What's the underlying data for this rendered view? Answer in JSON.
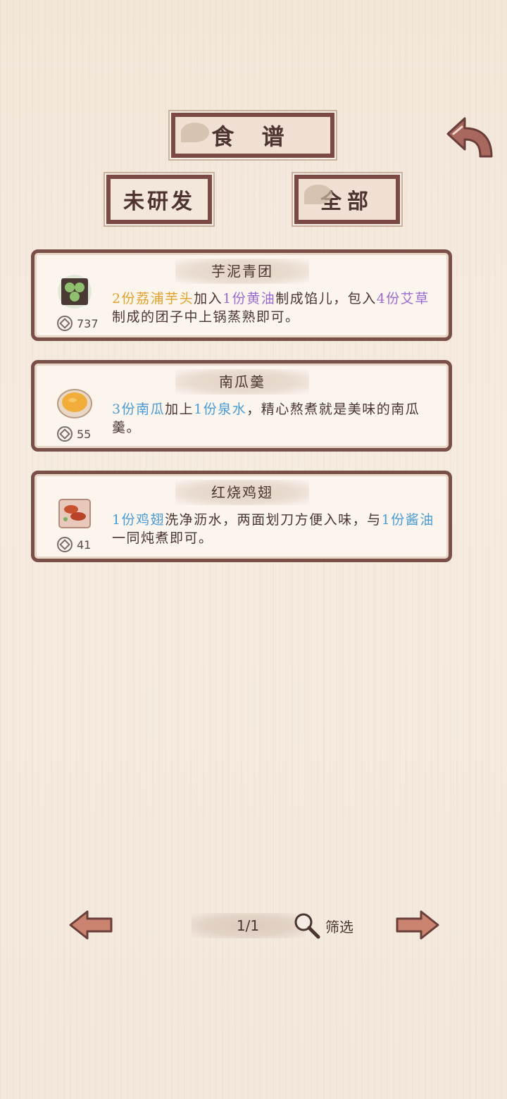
{
  "header": {
    "title": "食 谱",
    "tabs": [
      {
        "label": "未研发"
      },
      {
        "label": "全部"
      }
    ],
    "back_icon": "back-arrow-icon"
  },
  "recipes": [
    {
      "name": "芋泥青团",
      "price": "737",
      "icon": "qingtuan-dish-icon",
      "desc_parts": [
        {
          "text": "2份荔浦芋头",
          "color": "orange"
        },
        {
          "text": "加入",
          "color": "plain"
        },
        {
          "text": "1份黄油",
          "color": "purple"
        },
        {
          "text": "制成馅儿，包入",
          "color": "plain"
        },
        {
          "text": "4份艾草",
          "color": "purple"
        },
        {
          "text": "制成的团子中上锅蒸熟即可。",
          "color": "plain"
        }
      ]
    },
    {
      "name": "南瓜羹",
      "price": "55",
      "icon": "pumpkin-soup-icon",
      "desc_parts": [
        {
          "text": "3份南瓜",
          "color": "blue"
        },
        {
          "text": "加上",
          "color": "plain"
        },
        {
          "text": "1份泉水",
          "color": "blue"
        },
        {
          "text": "，精心熬煮就是美味的南瓜羹。",
          "color": "plain"
        }
      ]
    },
    {
      "name": "红烧鸡翅",
      "price": "41",
      "icon": "braised-wings-icon",
      "desc_parts": [
        {
          "text": "1份鸡翅",
          "color": "blue"
        },
        {
          "text": "洗净沥水，两面划刀方便入味，与",
          "color": "plain"
        },
        {
          "text": "1份酱油",
          "color": "blue"
        },
        {
          "text": "一同炖煮即可。",
          "color": "plain"
        }
      ]
    }
  ],
  "footer": {
    "page": "1/1",
    "filter_label": "筛选"
  },
  "colors": {
    "frame": "#7b4a44",
    "orange": "#e2a12a",
    "purple": "#9a6ad0",
    "blue": "#4a9bd3"
  }
}
